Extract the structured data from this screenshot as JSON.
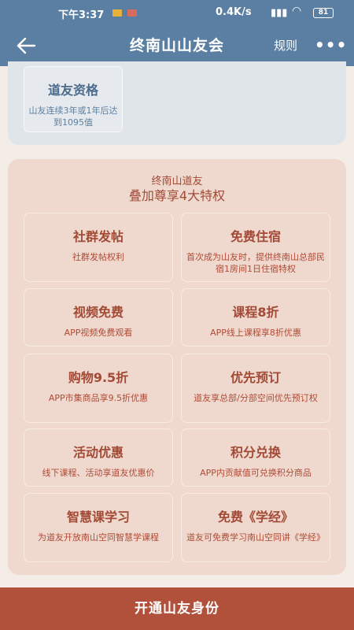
{
  "status_bar": {
    "time": "下午3:37",
    "network_speed": "0.4K/s",
    "signal": "▮▮▮",
    "battery": "81"
  },
  "nav": {
    "title": "终南山山友会",
    "rules_label": "规则",
    "more_label": "•••"
  },
  "qualification": {
    "title": "道友资格",
    "description": "山友连续3年或1年后达到1095值"
  },
  "privileges": {
    "subtitle": "终南山道友",
    "title": "叠加尊享4大特权",
    "items": [
      {
        "title": "社群发帖",
        "description": "社群发帖权利"
      },
      {
        "title": "免费住宿",
        "description": "首次成为山友时，提供终南山总部民宿1房间1日住宿特权"
      },
      {
        "title": "视频免费",
        "description": "APP视频免费观看"
      },
      {
        "title": "课程8折",
        "description": "APP线上课程享8折优惠"
      },
      {
        "title": "购物9.5折",
        "description": "APP市集商品享9.5折优惠"
      },
      {
        "title": "优先预订",
        "description": "道友享总部/分部空间优先预订权"
      },
      {
        "title": "活动优惠",
        "description": "线下课程、活动享道友优惠价"
      },
      {
        "title": "积分兑换",
        "description": "APP内贡献值可兑换积分商品"
      },
      {
        "title": "智慧课学习",
        "description": "为道友开放南山空同智慧学课程"
      },
      {
        "title": "免费《学经》",
        "description": "道友可免费学习南山空同讲《学经》"
      }
    ]
  },
  "cta": {
    "label": "开通山友身份"
  },
  "colors": {
    "header_bg": "#5a7fa2",
    "accent": "#a24a35",
    "cta_bg": "#b2513b"
  }
}
